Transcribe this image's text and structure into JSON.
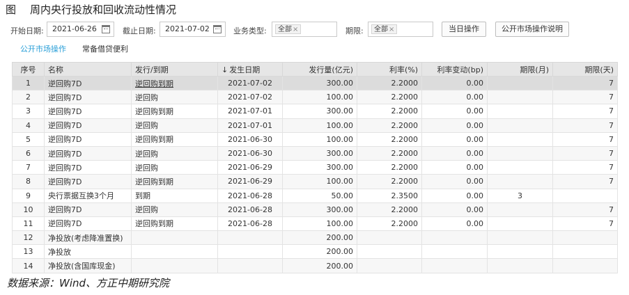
{
  "figure": {
    "label": "图",
    "title": "周内央行投放和回收流动性情况",
    "source": "数据来源：Wind、方正中期研究院"
  },
  "filters": {
    "start_label": "开始日期:",
    "start_value": "2021-06-26",
    "end_label": "截止日期:",
    "end_value": "2021-07-02",
    "biz_label": "业务类型:",
    "biz_tag": "全部",
    "term_label": "期限:",
    "term_tag": "全部",
    "today_button": "当日操作",
    "explain_button": "公开市场操作说明"
  },
  "tabs": [
    {
      "label": "公开市场操作",
      "active": true
    },
    {
      "label": "常备借贷便利",
      "active": false
    }
  ],
  "table": {
    "sort_icon": "arrow-down-icon",
    "headers": [
      "序号",
      "名称",
      "发行/到期",
      "发生日期",
      "发行量(亿元)",
      "利率(%)",
      "利率变动(bp)",
      "期限(月)",
      "期限(天)"
    ],
    "rows": [
      [
        "1",
        "逆回购7D",
        "逆回购到期",
        "2021-07-02",
        "300.00",
        "2.2000",
        "0.00",
        "",
        "7"
      ],
      [
        "2",
        "逆回购7D",
        "逆回购",
        "2021-07-02",
        "100.00",
        "2.2000",
        "0.00",
        "",
        "7"
      ],
      [
        "3",
        "逆回购7D",
        "逆回购到期",
        "2021-07-01",
        "300.00",
        "2.2000",
        "0.00",
        "",
        "7"
      ],
      [
        "4",
        "逆回购7D",
        "逆回购",
        "2021-07-01",
        "100.00",
        "2.2000",
        "0.00",
        "",
        "7"
      ],
      [
        "5",
        "逆回购7D",
        "逆回购到期",
        "2021-06-30",
        "100.00",
        "2.2000",
        "0.00",
        "",
        "7"
      ],
      [
        "6",
        "逆回购7D",
        "逆回购",
        "2021-06-30",
        "300.00",
        "2.2000",
        "0.00",
        "",
        "7"
      ],
      [
        "7",
        "逆回购7D",
        "逆回购",
        "2021-06-29",
        "300.00",
        "2.2000",
        "0.00",
        "",
        "7"
      ],
      [
        "8",
        "逆回购7D",
        "逆回购到期",
        "2021-06-29",
        "100.00",
        "2.2000",
        "0.00",
        "",
        "7"
      ],
      [
        "9",
        "央行票据互换3个月",
        "到期",
        "2021-06-28",
        "50.00",
        "2.3500",
        "0.00",
        "3",
        ""
      ],
      [
        "10",
        "逆回购7D",
        "逆回购",
        "2021-06-28",
        "300.00",
        "2.2000",
        "0.00",
        "",
        "7"
      ],
      [
        "11",
        "逆回购7D",
        "逆回购到期",
        "2021-06-28",
        "100.00",
        "2.2000",
        "0.00",
        "",
        "7"
      ],
      [
        "12",
        "净投放(考虑降准置换)",
        "",
        "",
        "200.00",
        "",
        "",
        "",
        ""
      ],
      [
        "13",
        "净投放",
        "",
        "",
        "200.00",
        "",
        "",
        "",
        ""
      ],
      [
        "14",
        "净投放(含国库现金)",
        "",
        "",
        "200.00",
        "",
        "",
        "",
        ""
      ]
    ]
  }
}
